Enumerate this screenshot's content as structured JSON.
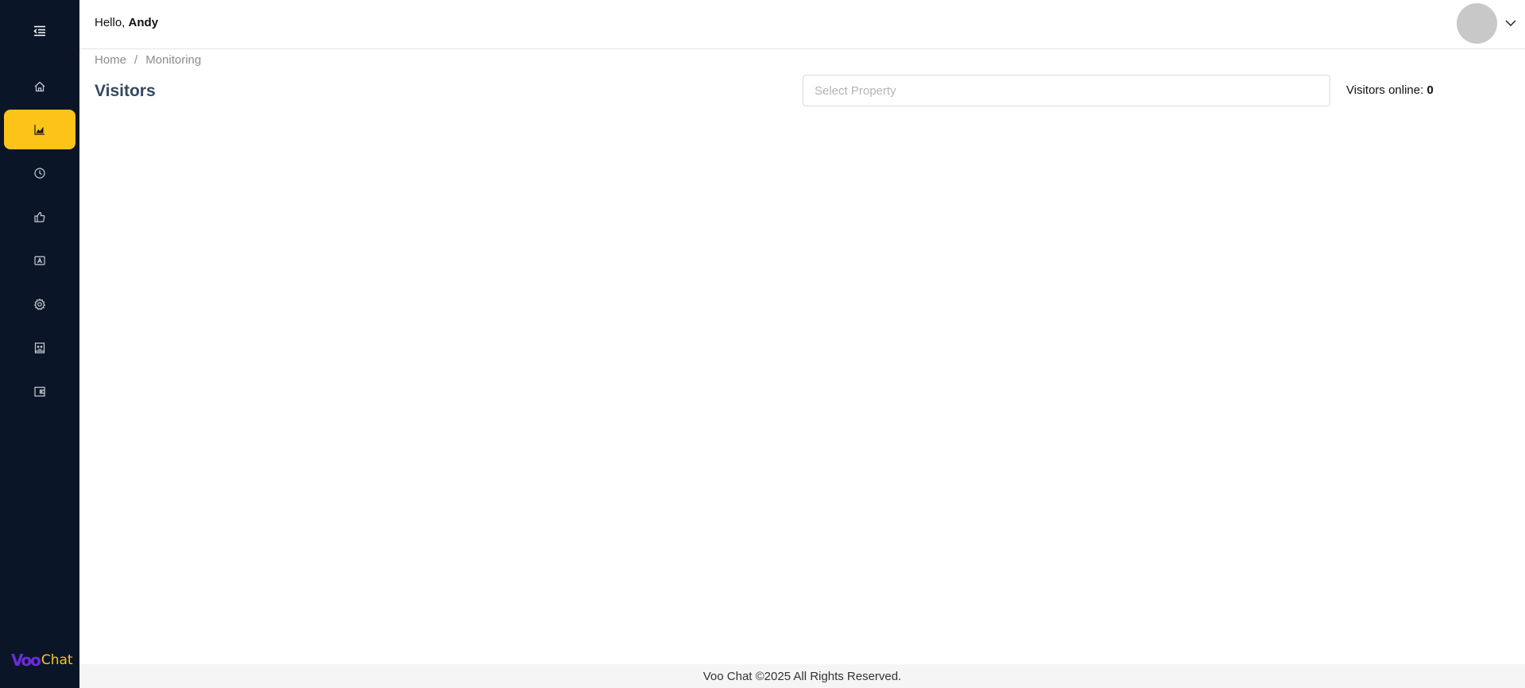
{
  "app": {
    "name": "Voo Chat",
    "brand_mark": "Voo",
    "brand_text": "Chat"
  },
  "colors": {
    "sidebar_bg": "#0a1628",
    "accent": "#fcc419",
    "brand_purple": "#6c2bd9",
    "title": "#34495e"
  },
  "header": {
    "greeting_prefix": "Hello, ",
    "user_name": "Andy"
  },
  "sidebar": {
    "items": [
      {
        "icon": "home-icon",
        "active": false
      },
      {
        "icon": "area-chart-icon",
        "active": true
      },
      {
        "icon": "clock-icon",
        "active": false
      },
      {
        "icon": "thumbs-up-icon",
        "active": false
      },
      {
        "icon": "contacts-icon",
        "active": false
      },
      {
        "icon": "gear-icon",
        "active": false
      },
      {
        "icon": "robot-icon",
        "active": false
      },
      {
        "icon": "wallet-icon",
        "active": false
      }
    ]
  },
  "breadcrumb": {
    "home": "Home",
    "separator": "/",
    "current": "Monitoring"
  },
  "main": {
    "title": "Visitors",
    "property_select": {
      "placeholder": "Select Property"
    },
    "visitors_online": {
      "label": "Visitors online: ",
      "count": "0"
    }
  },
  "footer": {
    "text": "Voo Chat ©2025 All Rights Reserved."
  }
}
